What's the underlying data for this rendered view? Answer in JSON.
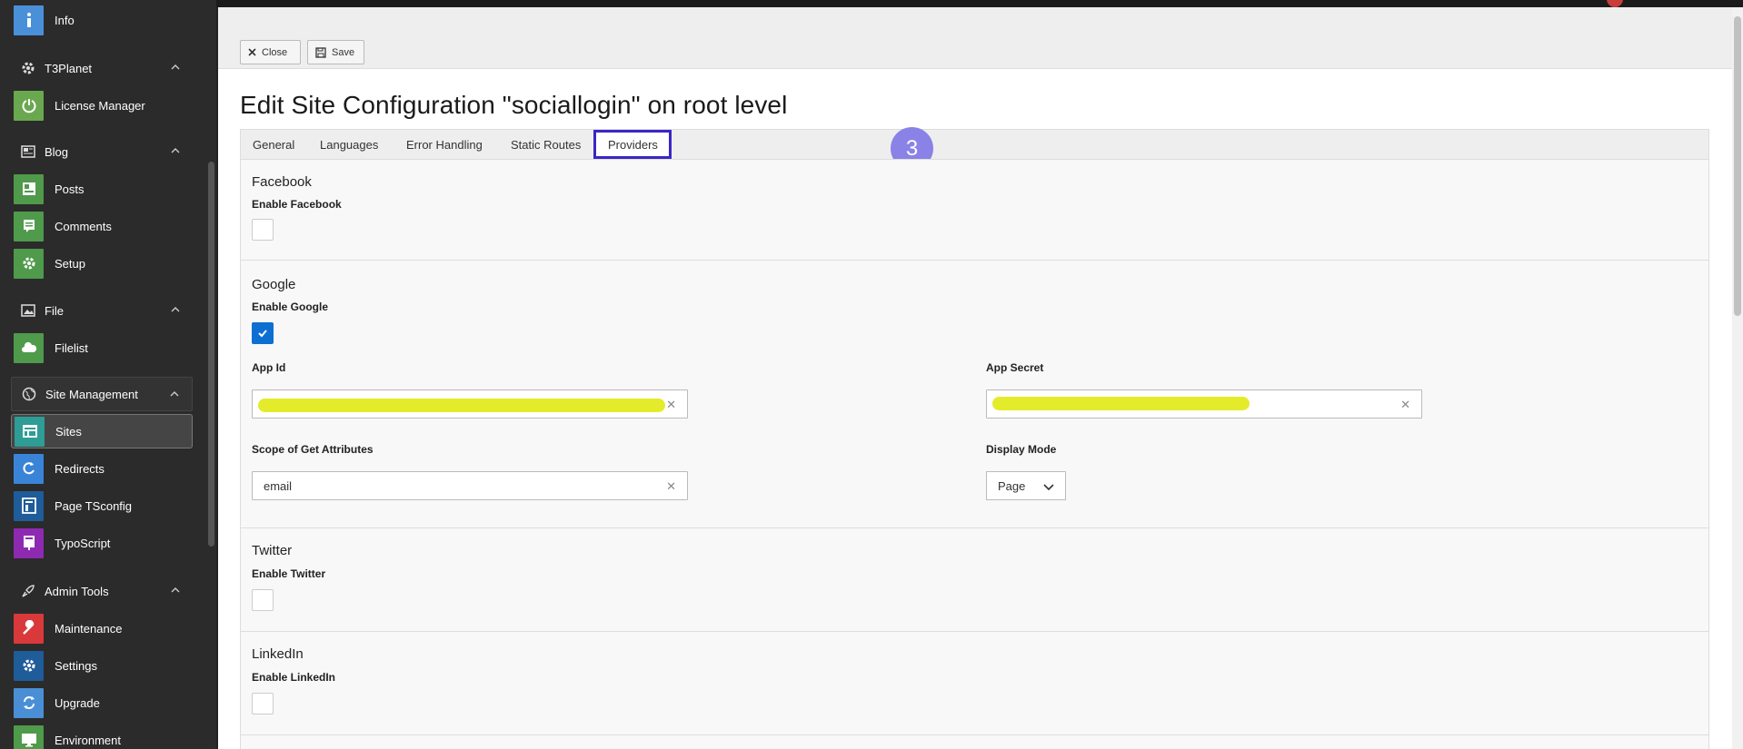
{
  "sidebar": {
    "items_top": [
      {
        "label": "Info",
        "color": "#4a90d9"
      }
    ],
    "groups": [
      {
        "label": "T3Planet"
      },
      {
        "label": "Blog"
      },
      {
        "label": "File"
      },
      {
        "label": "Site Management"
      },
      {
        "label": "Admin Tools"
      }
    ],
    "items": {
      "license_manager": "License Manager",
      "posts": "Posts",
      "comments": "Comments",
      "setup": "Setup",
      "filelist": "Filelist",
      "sites": "Sites",
      "redirects": "Redirects",
      "page_tsconfig": "Page TSconfig",
      "typoscript": "TypoScript",
      "maintenance": "Maintenance",
      "settings": "Settings",
      "upgrade": "Upgrade",
      "environment": "Environment"
    }
  },
  "toolbar": {
    "close_label": "Close",
    "save_label": "Save"
  },
  "page_title": "Edit Site Configuration \"sociallogin\" on root level",
  "tabs": {
    "general": "General",
    "languages": "Languages",
    "error_handling": "Error Handling",
    "static_routes": "Static Routes",
    "providers": "Providers"
  },
  "step_marker": "3",
  "providers": {
    "facebook": {
      "heading": "Facebook",
      "enable_label": "Enable Facebook",
      "enabled": false
    },
    "google": {
      "heading": "Google",
      "enable_label": "Enable Google",
      "enabled": true,
      "app_id_label": "App Id",
      "app_secret_label": "App Secret",
      "scope_label": "Scope of Get Attributes",
      "scope_value": "email",
      "display_mode_label": "Display Mode",
      "display_mode_value": "Page"
    },
    "twitter": {
      "heading": "Twitter",
      "enable_label": "Enable Twitter",
      "enabled": false
    },
    "linkedin": {
      "heading": "LinkedIn",
      "enable_label": "Enable LinkedIn",
      "enabled": false
    }
  },
  "colors": {
    "active_tab_border": "#3a26c7",
    "step_marker": "#8a82e6",
    "checkbox_checked": "#0d6fd1",
    "redaction_highlight": "#e4eb2a"
  }
}
